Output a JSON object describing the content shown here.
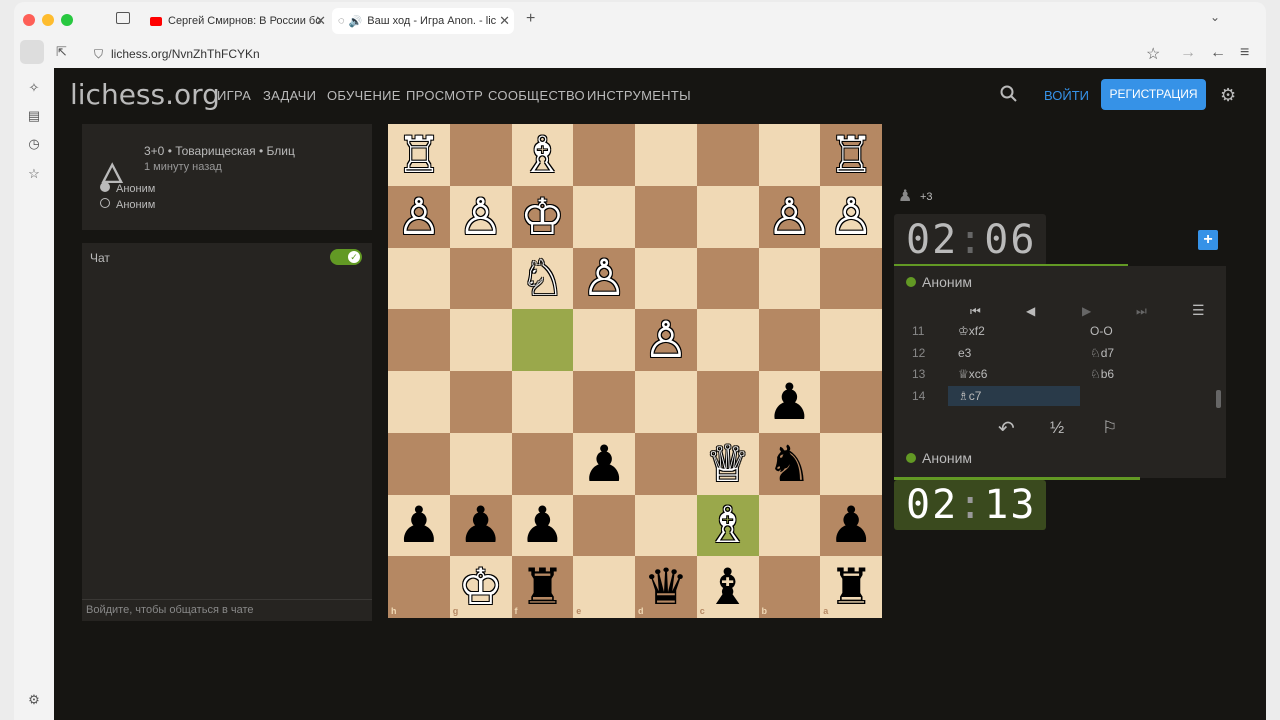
{
  "browser": {
    "tabs": [
      {
        "title": "Сергей Смирнов: В России бо",
        "icon": "youtube-icon"
      },
      {
        "title": "Ваш ход - Игра Anon. - lic",
        "icon": "loading-icon",
        "active": true
      }
    ],
    "url": "lichess.org/NvnZhThFCYKn"
  },
  "site": {
    "logo": "lichess",
    "logo_suffix": ".org",
    "nav": [
      "ИГРА",
      "ЗАДАЧИ",
      "ОБУЧЕНИЕ",
      "ПРОСМОТР",
      "СООБЩЕСТВО",
      "ИНСТРУМЕНТЫ"
    ],
    "login": "ВОЙТИ",
    "signup": "РЕГИСТРАЦИЯ"
  },
  "game_info": {
    "mode": "3+0 • Товарищеская • Блиц",
    "time": "1 минуту назад",
    "player_white": "Аноним",
    "player_black": "Аноним"
  },
  "chat": {
    "label": "Чат",
    "placeholder": "Войдите, чтобы общаться в чате"
  },
  "board": {
    "files": [
      "h",
      "g",
      "f",
      "e",
      "d",
      "c",
      "b",
      "a"
    ],
    "ranks": [
      "1",
      "2",
      "3",
      "4",
      "5",
      "6",
      "7",
      "8"
    ],
    "pieces": [
      [
        "♖",
        "",
        "♗",
        "",
        "",
        "",
        "",
        "♖"
      ],
      [
        "♙",
        "♙",
        "♔",
        "",
        "",
        "",
        "♙",
        "♙"
      ],
      [
        "",
        "",
        "♘",
        "♙",
        "",
        "",
        "",
        ""
      ],
      [
        "",
        "",
        "",
        "",
        "♙",
        "",
        "",
        ""
      ],
      [
        "",
        "",
        "",
        "",
        "",
        "",
        "♟",
        ""
      ],
      [
        "",
        "",
        "",
        "♟",
        "",
        "♕",
        "♞",
        ""
      ],
      [
        "♟",
        "♟",
        "♟",
        "",
        "",
        "♗",
        "",
        "♟"
      ],
      [
        "",
        "♔",
        "♜",
        "",
        "♛",
        "♝",
        "",
        "♜"
      ]
    ],
    "colors": [
      [
        "w",
        "",
        "w",
        "",
        "",
        "",
        "",
        "w"
      ],
      [
        "w",
        "w",
        "w",
        "",
        "",
        "",
        "w",
        "w"
      ],
      [
        "",
        "",
        "w",
        "w",
        "",
        "",
        "",
        ""
      ],
      [
        "",
        "",
        "",
        "",
        "w",
        "",
        "",
        ""
      ],
      [
        "",
        "",
        "",
        "",
        "",
        "",
        "b",
        ""
      ],
      [
        "",
        "",
        "",
        "b",
        "",
        "w",
        "b",
        ""
      ],
      [
        "b",
        "b",
        "b",
        "",
        "",
        "w",
        "",
        "b"
      ],
      [
        "",
        "w",
        "b",
        "",
        "b",
        "b",
        "",
        "b"
      ]
    ],
    "highlight": [
      [
        3,
        2
      ],
      [
        6,
        5
      ]
    ]
  },
  "right_panel": {
    "material": "+3",
    "top_clock": {
      "min": "02",
      "sec": "06"
    },
    "top_player": "Аноним",
    "moves": [
      {
        "n": "11",
        "w": "♔xf2",
        "b": "O-O"
      },
      {
        "n": "12",
        "w": "e3",
        "b": "♘d7"
      },
      {
        "n": "13",
        "w": "♕xc6",
        "b": "♘b6"
      },
      {
        "n": "14",
        "w": "♗c7",
        "b": ""
      }
    ],
    "bottom_player": "Аноним",
    "bottom_clock": {
      "min": "02",
      "sec": "13"
    }
  },
  "colors": {
    "accent": "#3692e7",
    "light_sq": "#f0d9b5",
    "dark_sq": "#b58863",
    "highlight": "#9aa84b",
    "clock_active": "#3a4a1e"
  }
}
